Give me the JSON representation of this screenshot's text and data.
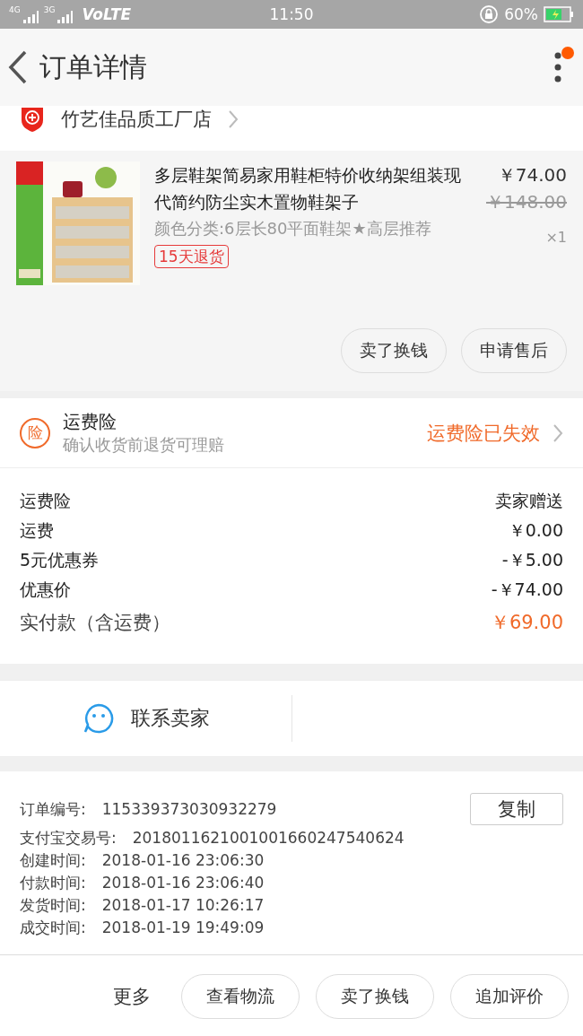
{
  "status_bar": {
    "network_1": "4G",
    "network_2": "3G",
    "volte": "VoLTE",
    "time": "11:50",
    "battery": "60%"
  },
  "header": {
    "title": "订单详情",
    "notification_dot": true
  },
  "shop": {
    "name": "竹艺佳品质工厂店"
  },
  "item": {
    "title": "多层鞋架简易家用鞋柜特价收纳架组装现代简约防尘实木置物鞋架子",
    "variant": "颜色分类:6层长80平面鞋架★高层推荐",
    "price": "￥74.00",
    "original_price": "￥148.00",
    "quantity": "×1",
    "tag": "15天退货",
    "actions": [
      "卖了换钱",
      "申请售后"
    ]
  },
  "insurance": {
    "badge": "险",
    "title": "运费险",
    "subtitle": "确认收货前退货可理赔",
    "status": "运费险已失效"
  },
  "costs": [
    {
      "kind": "line",
      "label": "运费险",
      "value": "卖家赠送"
    },
    {
      "kind": "line",
      "label": "运费",
      "value": "￥0.00"
    },
    {
      "kind": "line",
      "label": "5元优惠券",
      "value": "-￥5.00"
    },
    {
      "kind": "line",
      "label": "优惠价",
      "value": "-￥74.00"
    },
    {
      "kind": "total",
      "label": "实付款（含运费）",
      "value": "￥69.00"
    }
  ],
  "contact": {
    "label": "联系卖家"
  },
  "order_info": {
    "copy_button": "复制",
    "fields": [
      {
        "label": "订单编号:",
        "value": "115339373030932279"
      },
      {
        "label": "支付宝交易号:",
        "value": "2018011621001001660247540624"
      },
      {
        "label": "创建时间:",
        "value": "2018-01-16 23:06:30"
      },
      {
        "label": "付款时间:",
        "value": "2018-01-16 23:06:40"
      },
      {
        "label": "发货时间:",
        "value": "2018-01-17 10:26:17"
      },
      {
        "label": "成交时间:",
        "value": "2018-01-19 19:49:09"
      }
    ]
  },
  "bottom_bar": {
    "more": "更多",
    "buttons": [
      "查看物流",
      "卖了换钱",
      "追加评价"
    ]
  }
}
